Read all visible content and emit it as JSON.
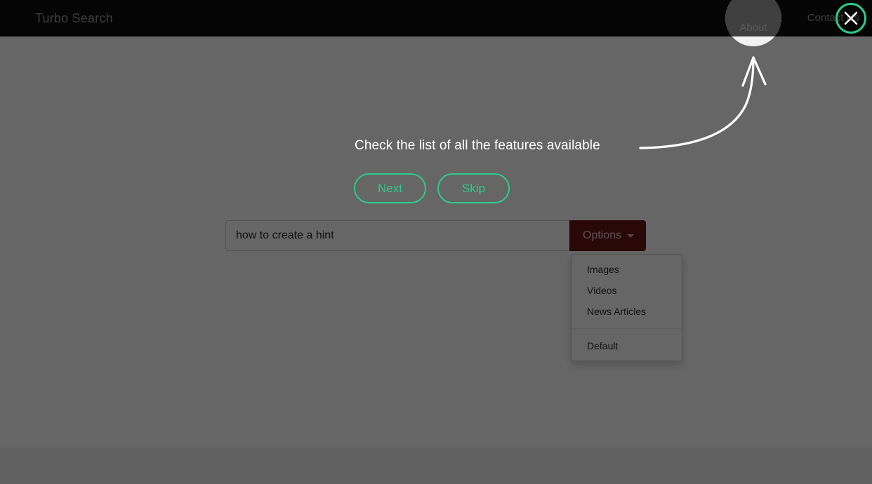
{
  "navbar": {
    "brand": "Turbo Search",
    "links": [
      {
        "label": "About",
        "highlighted": true
      },
      {
        "label": "Contact Us",
        "highlighted": false
      }
    ]
  },
  "search": {
    "value": "how to create a hint",
    "placeholder": "",
    "options_label": "Options",
    "caret_icon": "caret-down-icon"
  },
  "dropdown": {
    "items": [
      {
        "label": "Images"
      },
      {
        "label": "Videos"
      },
      {
        "label": "News Articles"
      }
    ],
    "footer_items": [
      {
        "label": "Default"
      }
    ]
  },
  "hint": {
    "text": "Check the list of all the features available",
    "next_label": "Next",
    "skip_label": "Skip",
    "close_icon": "close-icon",
    "arrow_icon": "curved-arrow-icon",
    "target": "About"
  },
  "colors": {
    "navbar_bg": "#0e0e0e",
    "overlay": "rgba(0,0,0,0.60)",
    "accent_green": "#2ecb8e",
    "options_red": "#6d1616",
    "hint_text": "#ffffff",
    "nav_link": "#9d9d9d"
  }
}
